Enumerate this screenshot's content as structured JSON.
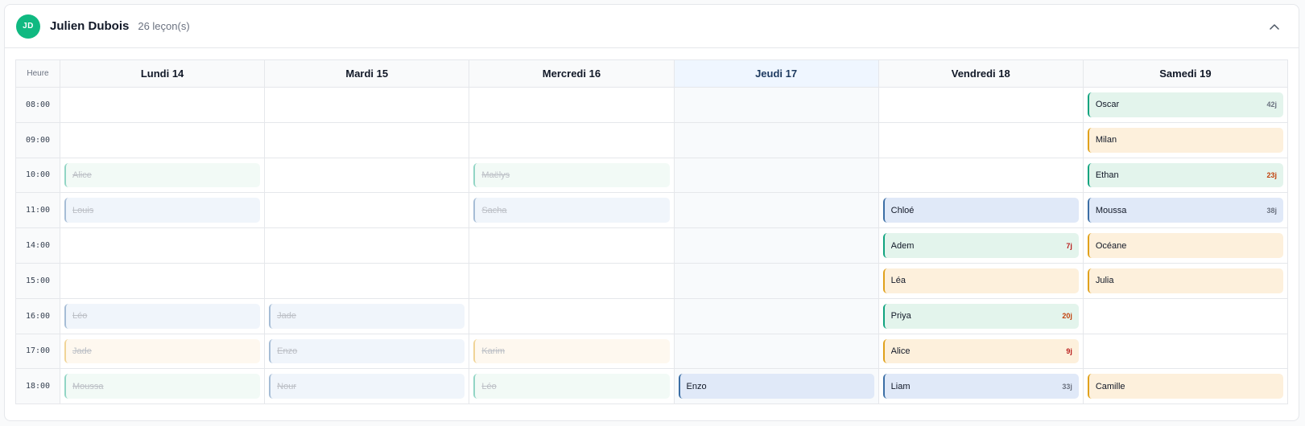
{
  "instructor": {
    "initials": "JD",
    "name": "Julien Dubois",
    "lesson_count": "26 leçon(s)"
  },
  "header": {
    "hour_label": "Heure"
  },
  "days": [
    {
      "label": "Lundi 14",
      "today": false
    },
    {
      "label": "Mardi 15",
      "today": false
    },
    {
      "label": "Mercredi 16",
      "today": false
    },
    {
      "label": "Jeudi 17",
      "today": true
    },
    {
      "label": "Vendredi 18",
      "today": false
    },
    {
      "label": "Samedi 19",
      "today": false
    }
  ],
  "times": [
    "08:00",
    "09:00",
    "10:00",
    "11:00",
    "14:00",
    "15:00",
    "16:00",
    "17:00",
    "18:00"
  ],
  "lessons": [
    {
      "day": 5,
      "slot": 0,
      "name": "Oscar",
      "badge": "42j",
      "color": "green",
      "past": false,
      "badge_color": "gray"
    },
    {
      "day": 5,
      "slot": 1,
      "name": "Milan",
      "badge": "",
      "color": "orange",
      "past": false
    },
    {
      "day": 0,
      "slot": 2,
      "name": "Alice",
      "badge": "",
      "color": "green",
      "past": true
    },
    {
      "day": 2,
      "slot": 2,
      "name": "Maëlys",
      "badge": "",
      "color": "green",
      "past": true
    },
    {
      "day": 5,
      "slot": 2,
      "name": "Ethan",
      "badge": "23j",
      "color": "green",
      "past": false,
      "badge_color": "orange"
    },
    {
      "day": 0,
      "slot": 3,
      "name": "Louis",
      "badge": "",
      "color": "blue",
      "past": true
    },
    {
      "day": 2,
      "slot": 3,
      "name": "Sacha",
      "badge": "",
      "color": "blue",
      "past": true
    },
    {
      "day": 4,
      "slot": 3,
      "name": "Chloé",
      "badge": "",
      "color": "blue",
      "past": false
    },
    {
      "day": 5,
      "slot": 3,
      "name": "Moussa",
      "badge": "38j",
      "color": "blue",
      "past": false,
      "badge_color": "gray"
    },
    {
      "day": 4,
      "slot": 4,
      "name": "Adem",
      "badge": "7j",
      "color": "green",
      "past": false,
      "badge_color": "red"
    },
    {
      "day": 5,
      "slot": 4,
      "name": "Océane",
      "badge": "",
      "color": "orange",
      "past": false
    },
    {
      "day": 4,
      "slot": 5,
      "name": "Léa",
      "badge": "",
      "color": "orange",
      "past": false
    },
    {
      "day": 5,
      "slot": 5,
      "name": "Julia",
      "badge": "",
      "color": "orange",
      "past": false
    },
    {
      "day": 0,
      "slot": 6,
      "name": "Léo",
      "badge": "",
      "color": "blue",
      "past": true
    },
    {
      "day": 1,
      "slot": 6,
      "name": "Jade",
      "badge": "",
      "color": "blue",
      "past": true
    },
    {
      "day": 4,
      "slot": 6,
      "name": "Priya",
      "badge": "20j",
      "color": "green",
      "past": false,
      "badge_color": "orange"
    },
    {
      "day": 0,
      "slot": 7,
      "name": "Jade",
      "badge": "",
      "color": "orange",
      "past": true
    },
    {
      "day": 1,
      "slot": 7,
      "name": "Enzo",
      "badge": "",
      "color": "blue",
      "past": true
    },
    {
      "day": 2,
      "slot": 7,
      "name": "Karim",
      "badge": "",
      "color": "orange",
      "past": true
    },
    {
      "day": 4,
      "slot": 7,
      "name": "Alice",
      "badge": "9j",
      "color": "orange",
      "past": false,
      "badge_color": "red"
    },
    {
      "day": 0,
      "slot": 8,
      "name": "Moussa",
      "badge": "",
      "color": "green",
      "past": true
    },
    {
      "day": 1,
      "slot": 8,
      "name": "Nour",
      "badge": "",
      "color": "blue",
      "past": true
    },
    {
      "day": 2,
      "slot": 8,
      "name": "Léo",
      "badge": "",
      "color": "green",
      "past": true
    },
    {
      "day": 3,
      "slot": 8,
      "name": "Enzo",
      "badge": "",
      "color": "blue",
      "past": false
    },
    {
      "day": 4,
      "slot": 8,
      "name": "Liam",
      "badge": "33j",
      "color": "blue",
      "past": false,
      "badge_color": "gray"
    },
    {
      "day": 5,
      "slot": 8,
      "name": "Camille",
      "badge": "",
      "color": "orange",
      "past": false
    }
  ],
  "colors": {
    "green": "#10a37f",
    "orange": "#e0a11b",
    "blue": "#3b6ea5",
    "avatar": "#10b981"
  }
}
